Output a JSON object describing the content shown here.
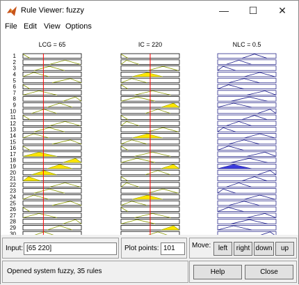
{
  "window": {
    "title": "Rule Viewer: fuzzy",
    "controls": [
      "—",
      "☐",
      "✕"
    ]
  },
  "menu": [
    "File",
    "Edit",
    "View",
    "Options"
  ],
  "columns": [
    {
      "header": "LCG = 65",
      "input_marker": 0.35
    },
    {
      "header": "IC = 220",
      "input_marker": 0.5
    },
    {
      "header": "NLC = 0.5"
    }
  ],
  "rule_labels": [
    "1",
    "2",
    "3",
    "4",
    "5",
    "6",
    "7",
    "8",
    "9",
    "10",
    "11",
    "12",
    "13",
    "14",
    "15",
    "16",
    "17",
    "18",
    "19",
    "20",
    "21",
    "22",
    "23",
    "24",
    "25",
    "26",
    "27",
    "28",
    "29",
    "30"
  ],
  "input": {
    "label": "Input:",
    "value": "[65 220]"
  },
  "plot_points": {
    "label": "Plot points:",
    "value": "101"
  },
  "move": {
    "label": "Move:",
    "buttons": [
      "left",
      "right",
      "down",
      "up"
    ]
  },
  "status": "Opened system fuzzy, 35 rules",
  "actions": {
    "help": "Help",
    "close": "Close"
  },
  "colors": {
    "fill": "#ffe600",
    "output_fill": "#3b3bdd",
    "curve": "#8a9a00",
    "output_curve": "#1c1c8a",
    "marker": "#ff0000"
  }
}
